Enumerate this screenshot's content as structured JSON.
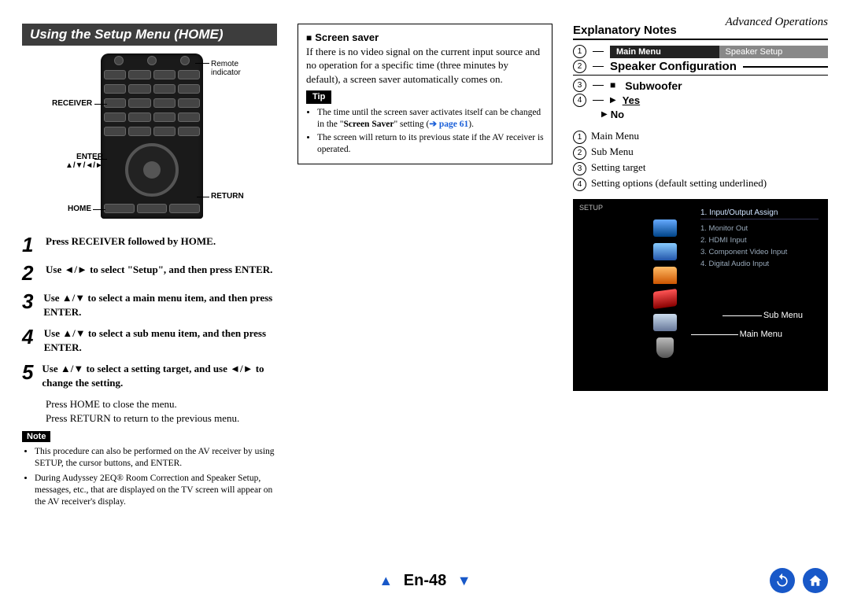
{
  "header": {
    "breadcrumb": "Advanced Operations"
  },
  "col1": {
    "title": "Using the Setup Menu (HOME)",
    "remote_labels": {
      "indicator": "Remote indicator",
      "receiver": "RECEIVER",
      "enter_arrows": "ENTER\n▲/▼/◄/►",
      "home": "HOME",
      "return": "RETURN"
    },
    "steps": [
      {
        "n": "1",
        "t": "Press RECEIVER followed by HOME."
      },
      {
        "n": "2",
        "t": "Use ◄/► to select \"Setup\", and then press ENTER."
      },
      {
        "n": "3",
        "t": "Use ▲/▼ to select a main menu item, and then press ENTER."
      },
      {
        "n": "4",
        "t": "Use ▲/▼ to select a sub menu item, and then press ENTER."
      },
      {
        "n": "5",
        "t": "Use ▲/▼ to select a setting target, and use ◄/► to change the setting."
      }
    ],
    "after_steps_1": "Press HOME to close the menu.",
    "after_steps_2": "Press RETURN to return to the previous menu.",
    "note_label": "Note",
    "notes": [
      "This procedure can also be performed on the AV receiver by using SETUP, the cursor buttons, and ENTER.",
      "During Audyssey 2EQ® Room Correction and Speaker Setup, messages, etc., that are displayed on the TV screen will appear on the AV receiver's display."
    ]
  },
  "col2": {
    "box_title": "Screen saver",
    "box_body": "If there is no video signal on the current input source and no operation for a specific time (three minutes by default), a screen saver automatically comes on.",
    "tip_label": "Tip",
    "tip1_a": "The time until the screen saver activates itself can be changed in the \"",
    "tip1_b": "Screen Saver",
    "tip1_c": "\" setting (",
    "tip1_link": "➔ page 61",
    "tip1_d": ").",
    "tip2": "The screen will return to its previous state if the AV receiver is operated."
  },
  "col3": {
    "title": "Explanatory Notes",
    "bar_left": "Main Menu",
    "bar_right": "Speaker Setup",
    "row2": "Speaker Configuration",
    "row3": "Subwoofer",
    "opt_yes": "Yes",
    "opt_no": "No",
    "legend": [
      "Main Menu",
      "Sub Menu",
      "Setting target",
      "Setting options (default setting underlined)"
    ],
    "tv": {
      "setup": "SETUP",
      "menu_title": "1. Input/Output Assign",
      "items": [
        "1. Monitor Out",
        "2. HDMI Input",
        "3. Component Video Input",
        "4. Digital Audio Input"
      ],
      "label_sub": "Sub Menu",
      "label_main": "Main Menu"
    }
  },
  "footer": {
    "page": "En-48"
  }
}
